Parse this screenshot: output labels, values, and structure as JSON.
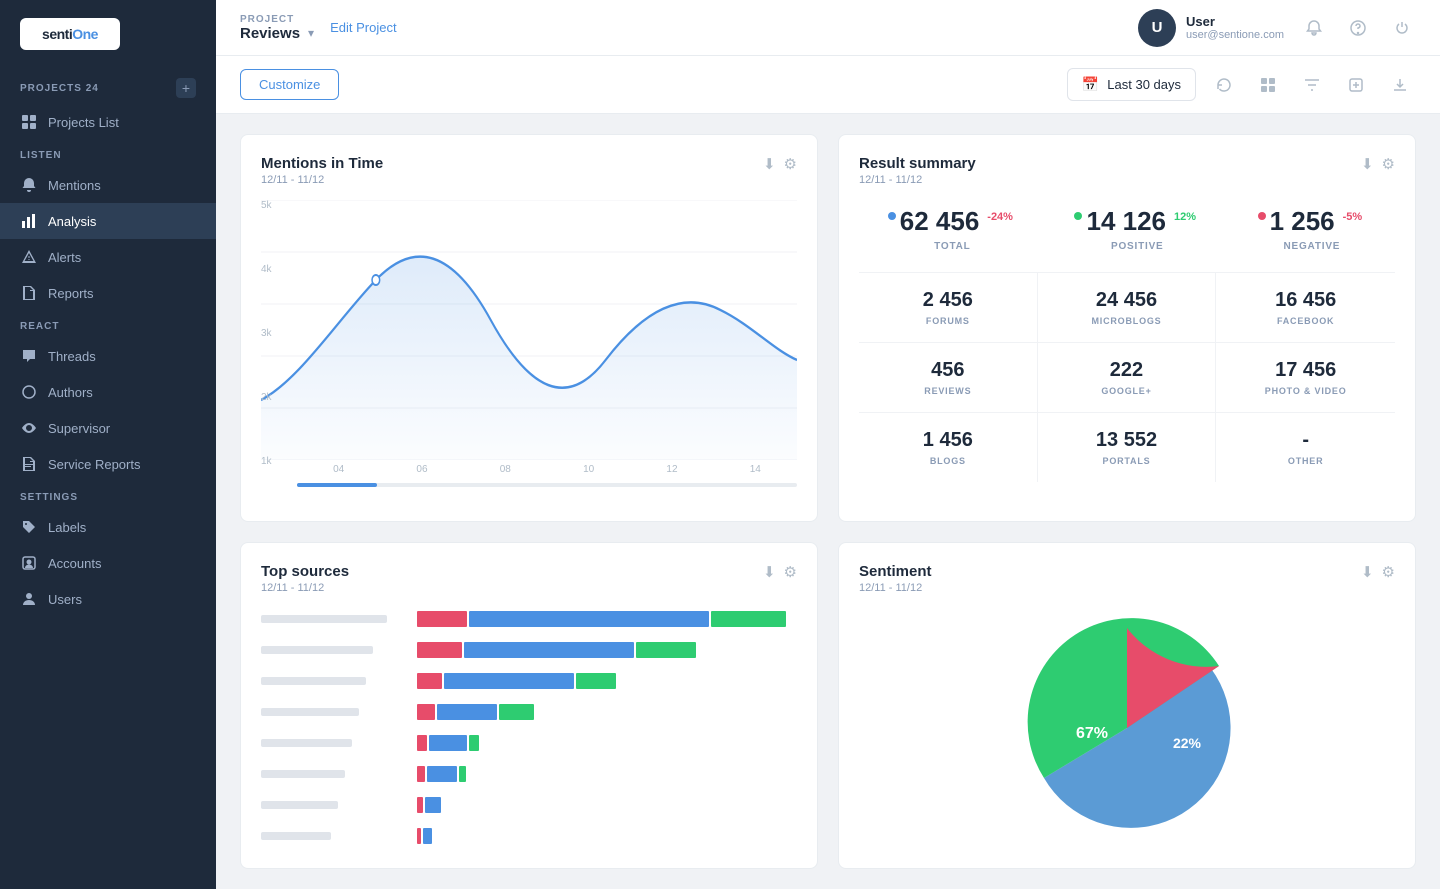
{
  "sidebar": {
    "logo": "sentiOne",
    "sections": [
      {
        "title": "Projects",
        "count": "24",
        "items": [
          {
            "id": "projects-list",
            "label": "Projects List",
            "icon": "grid"
          }
        ]
      },
      {
        "title": "Listen",
        "items": [
          {
            "id": "mentions",
            "label": "Mentions",
            "icon": "bell"
          },
          {
            "id": "analysis",
            "label": "Analysis",
            "icon": "bar-chart",
            "active": true
          },
          {
            "id": "alerts",
            "label": "Alerts",
            "icon": "alert"
          },
          {
            "id": "reports",
            "label": "Reports",
            "icon": "file"
          }
        ]
      },
      {
        "title": "React",
        "items": [
          {
            "id": "threads",
            "label": "Threads",
            "icon": "message"
          },
          {
            "id": "authors",
            "label": "Authors",
            "icon": "circle"
          },
          {
            "id": "supervisor",
            "label": "Supervisor",
            "icon": "eye"
          },
          {
            "id": "service-reports",
            "label": "Service Reports",
            "icon": "file-text"
          }
        ]
      },
      {
        "title": "Settings",
        "items": [
          {
            "id": "labels",
            "label": "Labels",
            "icon": "tag"
          },
          {
            "id": "accounts",
            "label": "Accounts",
            "icon": "user-square"
          },
          {
            "id": "users",
            "label": "Users",
            "icon": "user"
          }
        ]
      }
    ]
  },
  "header": {
    "project_label": "PROJECT",
    "project_name": "Reviews",
    "edit_link": "Edit Project",
    "user": {
      "initial": "U",
      "name": "User",
      "email": "user@sentione.com"
    }
  },
  "toolbar": {
    "customize_label": "Customize",
    "date_range": "Last 30 days"
  },
  "mentions_chart": {
    "title": "Mentions in Time",
    "date_range": "12/11 - 11/12",
    "y_labels": [
      "5k",
      "4k",
      "3k",
      "2k",
      "1k"
    ],
    "x_labels": [
      "04",
      "06",
      "08",
      "10",
      "12",
      "14"
    ]
  },
  "result_summary": {
    "title": "Result summary",
    "date_range": "12/11 - 11/12",
    "metrics": [
      {
        "id": "total",
        "value": "62 456",
        "label": "TOTAL",
        "badge": "-24%",
        "badge_type": "negative",
        "dot": "total"
      },
      {
        "id": "positive",
        "value": "14 126",
        "label": "POSITIVE",
        "badge": "12%",
        "badge_type": "positive",
        "dot": "positive"
      },
      {
        "id": "negative",
        "value": "1 256",
        "label": "NEGATIVE",
        "badge": "-5%",
        "badge_type": "negative",
        "dot": "negative"
      }
    ],
    "channels": [
      {
        "id": "forums",
        "value": "2 456",
        "label": "FORUMS"
      },
      {
        "id": "microblogs",
        "value": "24 456",
        "label": "MICROBLOGS"
      },
      {
        "id": "facebook",
        "value": "16 456",
        "label": "FACEBOOK"
      },
      {
        "id": "reviews",
        "value": "456",
        "label": "REVIEWS"
      },
      {
        "id": "googleplus",
        "value": "222",
        "label": "GOOGLE+"
      },
      {
        "id": "photo-video",
        "value": "17 456",
        "label": "PHOTO & VIDEO"
      },
      {
        "id": "blogs",
        "value": "1 456",
        "label": "BLOGS"
      },
      {
        "id": "portals",
        "value": "13 552",
        "label": "PORTALS"
      },
      {
        "id": "other",
        "value": "-",
        "label": "OTHER"
      }
    ]
  },
  "top_sources": {
    "title": "Top sources",
    "date_range": "12/11 - 11/12",
    "bars": [
      {
        "red": 60,
        "blue": 290,
        "green": 80
      },
      {
        "red": 55,
        "blue": 200,
        "green": 70
      },
      {
        "red": 30,
        "blue": 150,
        "green": 45
      },
      {
        "red": 20,
        "blue": 70,
        "green": 40
      },
      {
        "red": 12,
        "blue": 45,
        "green": 12
      },
      {
        "red": 10,
        "blue": 38,
        "green": 8
      },
      {
        "red": 8,
        "blue": 20,
        "green": 5
      },
      {
        "red": 5,
        "blue": 12,
        "green": 3
      }
    ]
  },
  "sentiment": {
    "title": "Sentiment",
    "date_range": "12/11 - 11/12",
    "neutral_pct": 67,
    "positive_pct": 22,
    "negative_pct": 11
  },
  "colors": {
    "blue": "#4a90e2",
    "green": "#2ecc71",
    "red": "#e74c6a",
    "neutral_blue": "#5b9bd5"
  }
}
